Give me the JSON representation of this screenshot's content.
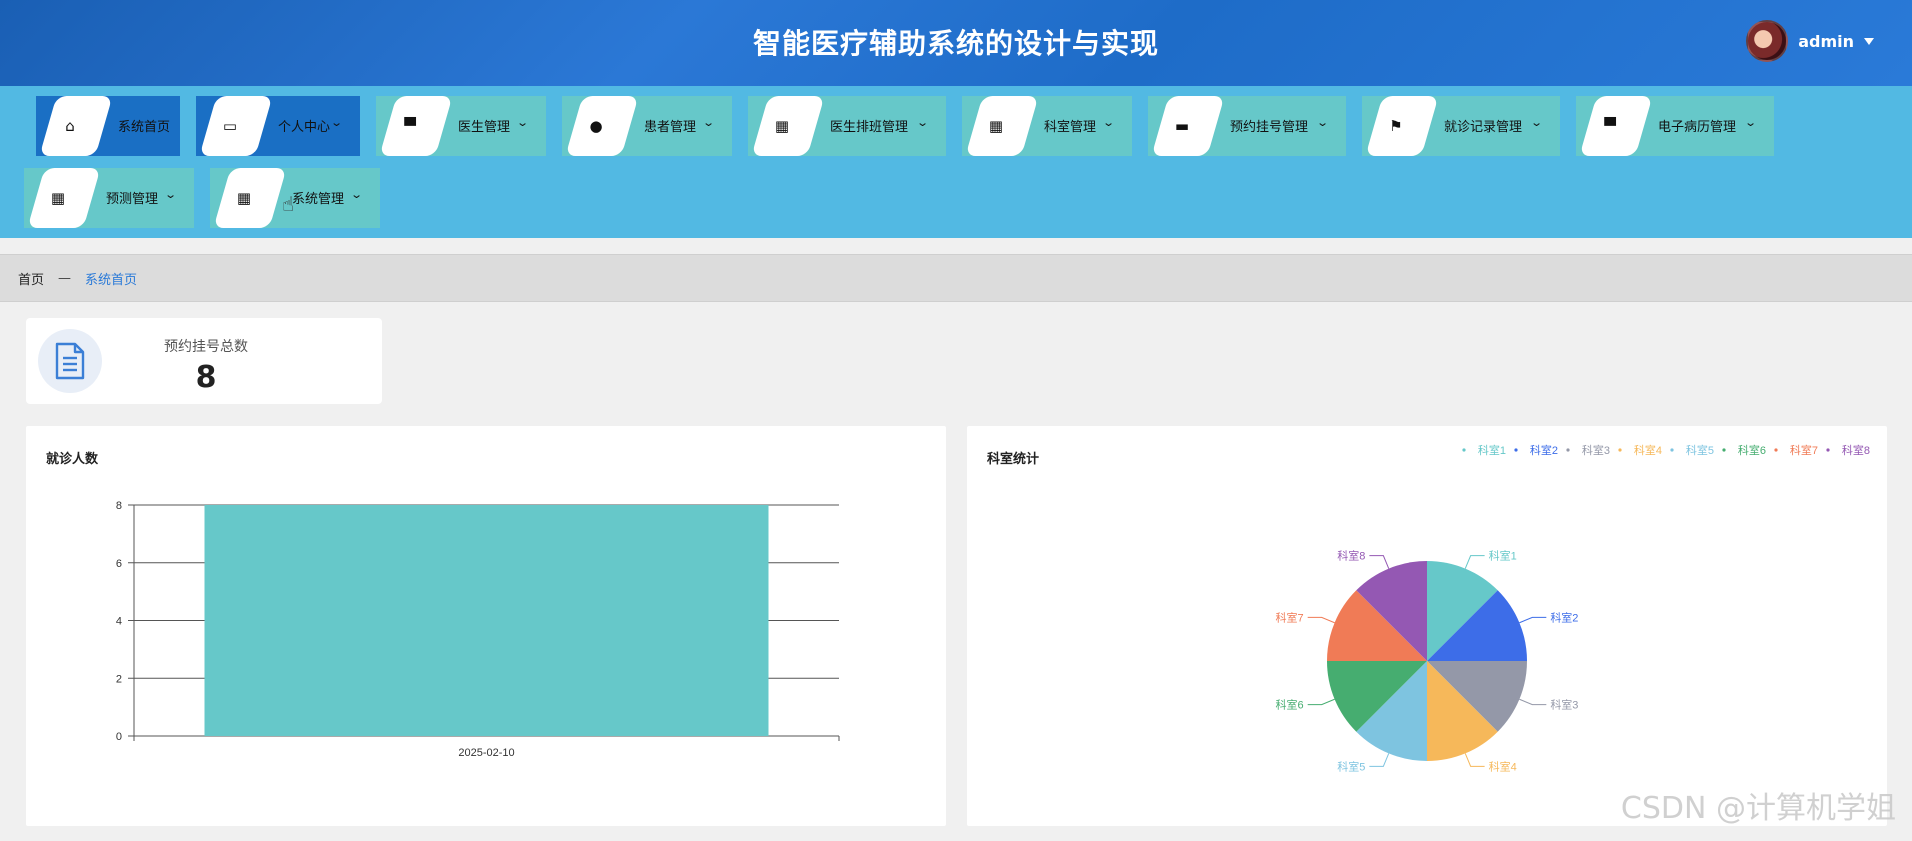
{
  "header": {
    "title": "智能医疗辅助系统的设计与实现",
    "username": "admin"
  },
  "nav": [
    {
      "label": "系统首页",
      "icon": "home-icon",
      "glyph": "⌂",
      "dropdown": false,
      "active": true
    },
    {
      "label": "个人中心",
      "icon": "wallet-icon",
      "glyph": "▭",
      "dropdown": true,
      "active": true
    },
    {
      "label": "医生管理",
      "icon": "brush-icon",
      "glyph": "▀",
      "dropdown": true,
      "active": false
    },
    {
      "label": "患者管理",
      "icon": "bulb-icon",
      "glyph": "●",
      "dropdown": true,
      "active": false
    },
    {
      "label": "医生排班管理",
      "icon": "grid-icon",
      "glyph": "▦",
      "dropdown": true,
      "active": false
    },
    {
      "label": "科室管理",
      "icon": "grid-icon",
      "glyph": "▦",
      "dropdown": true,
      "active": false
    },
    {
      "label": "预约挂号管理",
      "icon": "message-icon",
      "glyph": "▬",
      "dropdown": true,
      "active": false
    },
    {
      "label": "就诊记录管理",
      "icon": "flag-icon",
      "glyph": "⚑",
      "dropdown": true,
      "active": false
    },
    {
      "label": "电子病历管理",
      "icon": "monitor-icon",
      "glyph": "▀",
      "dropdown": true,
      "active": false
    },
    {
      "label": "预测管理",
      "icon": "grid-icon",
      "glyph": "▦",
      "dropdown": true,
      "active": false
    },
    {
      "label": "系统管理",
      "icon": "grid-icon",
      "glyph": "▦",
      "dropdown": true,
      "active": false
    }
  ],
  "breadcrumb": {
    "home": "首页",
    "separator": "—",
    "current": "系统首页"
  },
  "stat": {
    "label": "预约挂号总数",
    "value": "8"
  },
  "panels": {
    "left_title": "就诊人数",
    "right_title": "科室统计"
  },
  "watermark": "CSDN @计算机学姐",
  "chart_data": [
    {
      "type": "bar",
      "categories": [
        "2025-02-10"
      ],
      "values": [
        8
      ],
      "ylim": [
        0,
        8
      ],
      "yticks": [
        0,
        2,
        4,
        6,
        8
      ],
      "grid": true,
      "color": "#66c8c9"
    },
    {
      "type": "pie",
      "labels": [
        "科室1",
        "科室2",
        "科室3",
        "科室4",
        "科室5",
        "科室6",
        "科室7",
        "科室8"
      ],
      "values": [
        1,
        1,
        1,
        1,
        1,
        1,
        1,
        1
      ],
      "colors": [
        "#66c8c9",
        "#3d6de8",
        "#9498a8",
        "#f6b85a",
        "#7ec4e0",
        "#46ad70",
        "#f07b56",
        "#9458b3"
      ],
      "legend": "top-right"
    }
  ]
}
